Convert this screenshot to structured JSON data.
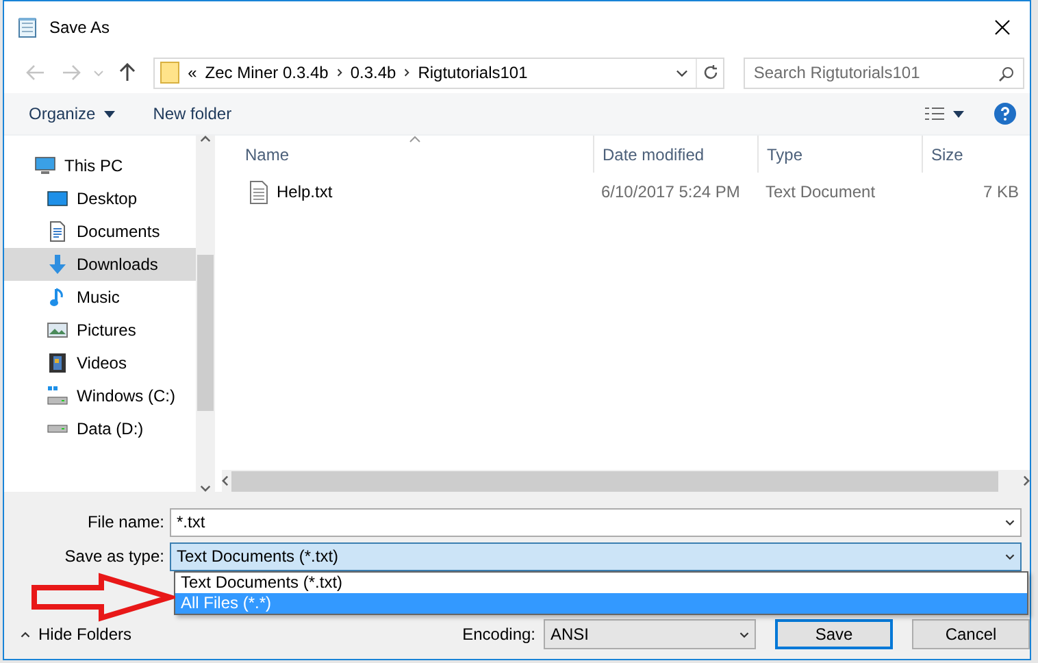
{
  "window": {
    "title": "Save As"
  },
  "address_bar": {
    "breadcrumbs": [
      "«",
      "Zec Miner 0.3.4b",
      "0.3.4b",
      "Rigtutorials101"
    ]
  },
  "search": {
    "placeholder": "Search Rigtutorials101"
  },
  "toolbar": {
    "organize": "Organize",
    "new_folder": "New folder"
  },
  "nav": {
    "items": [
      {
        "label": "This PC",
        "kind": "pc",
        "selected": false,
        "children": [
          {
            "label": "Desktop",
            "kind": "desktop",
            "selected": false
          },
          {
            "label": "Documents",
            "kind": "documents",
            "selected": false
          },
          {
            "label": "Downloads",
            "kind": "downloads",
            "selected": true
          },
          {
            "label": "Music",
            "kind": "music",
            "selected": false
          },
          {
            "label": "Pictures",
            "kind": "pictures",
            "selected": false
          },
          {
            "label": "Videos",
            "kind": "videos",
            "selected": false
          },
          {
            "label": "Windows (C:)",
            "kind": "system_drive",
            "selected": false
          },
          {
            "label": "Data (D:)",
            "kind": "drive",
            "selected": false
          }
        ]
      }
    ]
  },
  "table": {
    "columns": [
      "Name",
      "Date modified",
      "Type",
      "Size"
    ],
    "rows": [
      {
        "name": "Help.txt",
        "date": "6/10/2017 5:24 PM",
        "type": "Text Document",
        "size": "7 KB"
      }
    ]
  },
  "form": {
    "file_name_label": "File name:",
    "file_name": "*.txt",
    "save_type_label": "Save as type:",
    "save_type": "Text Documents (*.txt)",
    "options": [
      {
        "label": "Text Documents (*.txt)",
        "selected": false
      },
      {
        "label": "All Files  (*.*)",
        "selected": true
      }
    ],
    "hide_folders": "Hide Folders",
    "encoding_label": "Encoding:",
    "encoding": "ANSI",
    "buttons": [
      "Save",
      "Cancel"
    ]
  }
}
